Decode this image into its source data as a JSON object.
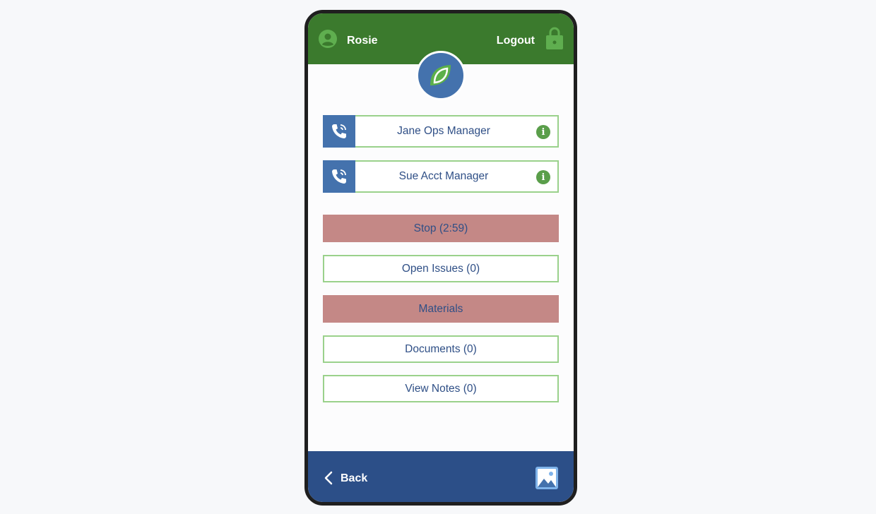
{
  "header": {
    "user_name": "Rosie",
    "logout_label": "Logout",
    "user_icon": "account-circle-icon",
    "lock_icon": "lock-icon"
  },
  "logo": {
    "icon": "leaf-logo-icon"
  },
  "contacts": [
    {
      "name": "Jane Ops Manager",
      "icon": "phone-call-icon",
      "info_glyph": "i"
    },
    {
      "name": "Sue Acct Manager",
      "icon": "phone-call-icon",
      "info_glyph": "i"
    }
  ],
  "actions": {
    "stop_label": "Stop (2:59)",
    "open_issues_label": "Open Issues (0)",
    "materials_label": "Materials",
    "documents_label": "Documents (0)",
    "view_notes_label": "View Notes (0)"
  },
  "footer": {
    "back_label": "Back",
    "back_icon": "chevron-left-icon",
    "gallery_icon": "image-gallery-icon"
  },
  "colors": {
    "header_green": "#3b7a2d",
    "footer_blue": "#2c4f88",
    "accent_blue": "#4472ad",
    "alert_button": "#c48886",
    "border_green": "#9ad18b",
    "text_blue": "#2f4f86"
  }
}
